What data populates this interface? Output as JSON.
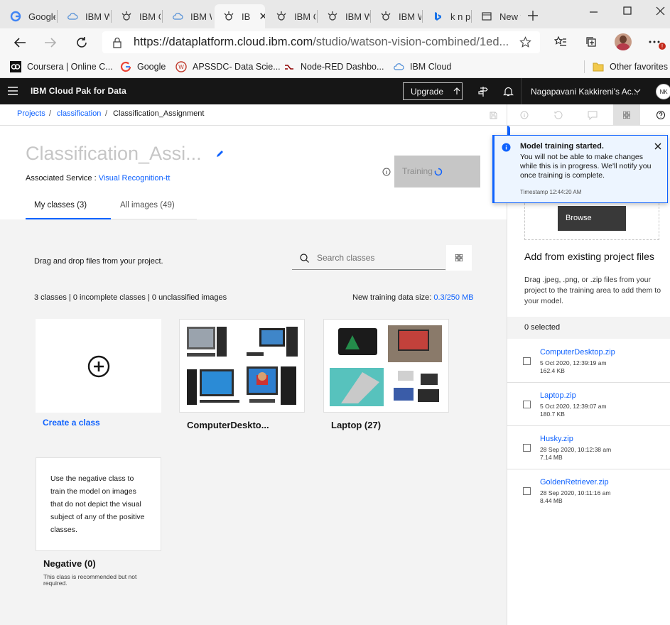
{
  "browser": {
    "tabs": [
      {
        "label": "Google",
        "icon": "google-icon"
      },
      {
        "label": "IBM W",
        "icon": "cloud-icon"
      },
      {
        "label": "IBM Cl",
        "icon": "ibm-bulb-icon"
      },
      {
        "label": "IBM W",
        "icon": "cloud-icon"
      },
      {
        "label": "IB",
        "icon": "ibm-bulb-icon",
        "active": true
      },
      {
        "label": "IBM Cl",
        "icon": "ibm-bulb-icon"
      },
      {
        "label": "IBM W",
        "icon": "ibm-bulb-icon"
      },
      {
        "label": "IBM W",
        "icon": "ibm-bulb-icon"
      },
      {
        "label": "k n pa",
        "icon": "bing-icon"
      },
      {
        "label": "New ta",
        "icon": "newtab-icon"
      }
    ],
    "url_host": "https://dataplatform.cloud.ibm.com",
    "url_path": "/studio/watson-vision-combined/1ed...",
    "bookmarks": [
      "Coursera | Online C...",
      "Google",
      "APSSDC- Data Scie...",
      "Node-RED Dashbo...",
      "IBM Cloud"
    ],
    "other_favorites": "Other favorites",
    "accent": "#0f62fe"
  },
  "header": {
    "brand": "IBM Cloud Pak for Data",
    "upgrade": "Upgrade",
    "account": "Nagapavani Kakkireni's Ac...",
    "avatar": "NK"
  },
  "breadcrumb": {
    "projects": "Projects",
    "classification": "classification",
    "current": "Classification_Assignment",
    "sep": "/"
  },
  "model": {
    "title": "Classification_Assi...",
    "assoc_label": "Associated Service :",
    "assoc_service": "Visual Recognition-tt",
    "training": "Training"
  },
  "tabs": {
    "my_classes": "My classes (3)",
    "all_images": "All images (49)"
  },
  "content": {
    "drag_drop": "Drag and drop files from your project.",
    "search_placeholder": "Search classes",
    "summary": "3 classes | 0 incomplete classes | 0 unclassified images",
    "data_size_label": "New training data size:",
    "data_size_value": "0.3/250 MB",
    "create_class": "Create a class",
    "class_computer": "ComputerDeskto...",
    "class_laptop": "Laptop (27)",
    "negative_desc": "Use the negative class to train the model on images that do not depict the visual subject of any of the positive classes.",
    "negative_title": "Negative (0)",
    "negative_note": "This class is recommended but not required."
  },
  "right_panel": {
    "browse": "Browse",
    "add_existing": "Add from existing project files",
    "drag_help": "Drag .jpeg, .png, or .zip files from your project to the training area to add them to your model.",
    "selected": "0 selected",
    "files": [
      {
        "name": "ComputerDesktop.zip",
        "date": "5 Oct 2020, 12:39:19 am",
        "size": "162.4 KB"
      },
      {
        "name": "Laptop.zip",
        "date": "5 Oct 2020, 12:39:07 am",
        "size": "180.7 KB"
      },
      {
        "name": "Husky.zip",
        "date": "28 Sep 2020, 10:12:38 am",
        "size": "7.14 MB"
      },
      {
        "name": "GoldenRetriever.zip",
        "date": "28 Sep 2020, 10:11:16 am",
        "size": "8.44 MB"
      }
    ]
  },
  "toast": {
    "title": "Model training started.",
    "body": "You will not be able to make changes while this is in progress. We'll notify you once training is complete.",
    "timestamp": "Timestamp 12:44:20 AM"
  }
}
